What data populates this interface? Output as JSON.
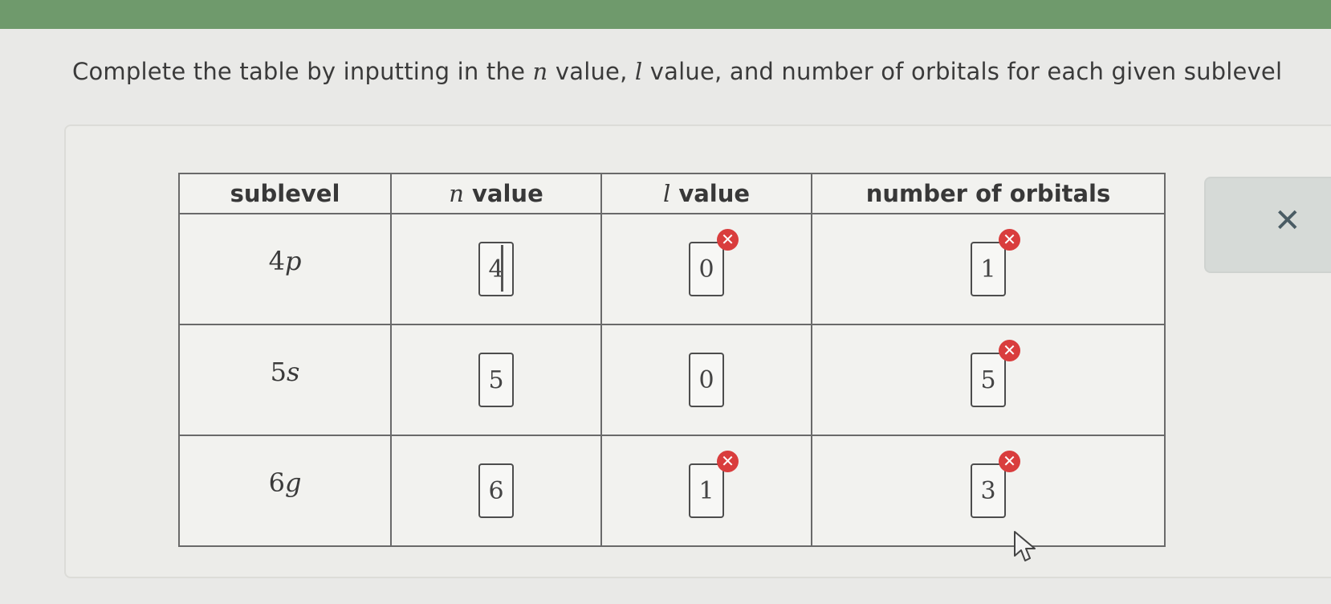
{
  "instruction": {
    "part1": "Complete the table by inputting in the ",
    "n_symbol": "n",
    "part2": " value, ",
    "l_symbol": "l",
    "part3": " value, and number of orbitals for each given sublevel"
  },
  "table": {
    "headers": {
      "sublevel": "sublevel",
      "n_symbol": "n",
      "n_suffix": " value",
      "l_symbol": "l",
      "l_suffix": " value",
      "orbitals": "number of orbitals"
    },
    "rows": [
      {
        "sub_num": "4",
        "sub_letter": "p",
        "n": "4",
        "l": "0",
        "orbitals": "1",
        "l_error": true,
        "orbitals_error": true
      },
      {
        "sub_num": "5",
        "sub_letter": "s",
        "n": "5",
        "l": "0",
        "orbitals": "5",
        "l_error": false,
        "orbitals_error": true
      },
      {
        "sub_num": "6",
        "sub_letter": "g",
        "n": "6",
        "l": "1",
        "orbitals": "3",
        "l_error": true,
        "orbitals_error": true
      }
    ]
  },
  "error_icon_glyph": "✕",
  "side_panel": {
    "close_glyph": "✕"
  },
  "colors": {
    "top_bar": "#6f9a6c",
    "error": "#d93d3d"
  }
}
